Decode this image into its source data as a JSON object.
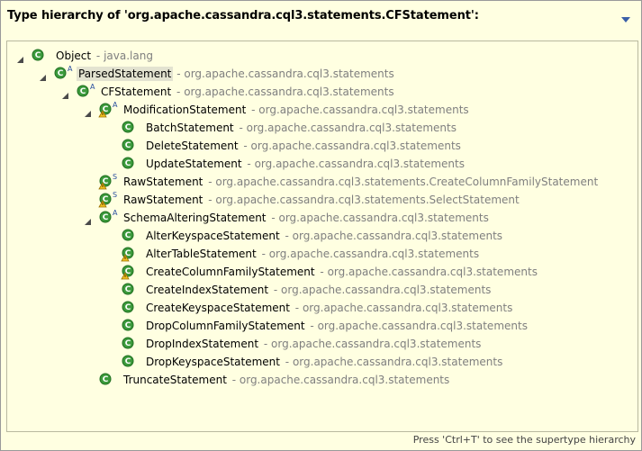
{
  "title": "Type hierarchy of 'org.apache.cassandra.cql3.statements.CFStatement':",
  "menu_icon": "view-menu-triangle-icon",
  "status_text": "Press 'Ctrl+T' to see the supertype hierarchy",
  "colors": {
    "background": "#ffffe1",
    "class_icon_green": "#3c9a3c",
    "package_gray": "#7f7f7f",
    "title_menu_blue": "#3a5fa8"
  },
  "rows": [
    {
      "level": 0,
      "expander": "expanded",
      "icon": "class",
      "badge": "",
      "warn": false,
      "name": "Object",
      "sep": " - ",
      "pkg": "java.lang",
      "selected": false
    },
    {
      "level": 1,
      "expander": "expanded",
      "icon": "class",
      "badge": "A",
      "warn": false,
      "name": "ParsedStatement",
      "sep": " - ",
      "pkg": "org.apache.cassandra.cql3.statements",
      "selected": true
    },
    {
      "level": 2,
      "expander": "expanded",
      "icon": "class",
      "badge": "A",
      "warn": false,
      "name": "CFStatement",
      "sep": " - ",
      "pkg": "org.apache.cassandra.cql3.statements",
      "selected": false
    },
    {
      "level": 3,
      "expander": "expanded",
      "icon": "class",
      "badge": "A",
      "warn": true,
      "name": "ModificationStatement",
      "sep": " - ",
      "pkg": "org.apache.cassandra.cql3.statements",
      "selected": false
    },
    {
      "level": 4,
      "expander": "none",
      "icon": "class",
      "badge": "",
      "warn": false,
      "name": "BatchStatement",
      "sep": " - ",
      "pkg": "org.apache.cassandra.cql3.statements",
      "selected": false
    },
    {
      "level": 4,
      "expander": "none",
      "icon": "class",
      "badge": "",
      "warn": false,
      "name": "DeleteStatement",
      "sep": " - ",
      "pkg": "org.apache.cassandra.cql3.statements",
      "selected": false
    },
    {
      "level": 4,
      "expander": "none",
      "icon": "class",
      "badge": "",
      "warn": false,
      "name": "UpdateStatement",
      "sep": " - ",
      "pkg": "org.apache.cassandra.cql3.statements",
      "selected": false
    },
    {
      "level": 3,
      "expander": "none",
      "icon": "class",
      "badge": "S",
      "warn": true,
      "name": "RawStatement",
      "sep": " - ",
      "pkg": "org.apache.cassandra.cql3.statements.CreateColumnFamilyStatement",
      "selected": false
    },
    {
      "level": 3,
      "expander": "none",
      "icon": "class",
      "badge": "S",
      "warn": true,
      "name": "RawStatement",
      "sep": " - ",
      "pkg": "org.apache.cassandra.cql3.statements.SelectStatement",
      "selected": false
    },
    {
      "level": 3,
      "expander": "expanded",
      "icon": "class",
      "badge": "A",
      "warn": false,
      "name": "SchemaAlteringStatement",
      "sep": " - ",
      "pkg": "org.apache.cassandra.cql3.statements",
      "selected": false
    },
    {
      "level": 4,
      "expander": "none",
      "icon": "class",
      "badge": "",
      "warn": false,
      "name": "AlterKeyspaceStatement",
      "sep": " - ",
      "pkg": "org.apache.cassandra.cql3.statements",
      "selected": false
    },
    {
      "level": 4,
      "expander": "none",
      "icon": "class",
      "badge": "",
      "warn": true,
      "name": "AlterTableStatement",
      "sep": " - ",
      "pkg": "org.apache.cassandra.cql3.statements",
      "selected": false
    },
    {
      "level": 4,
      "expander": "none",
      "icon": "class",
      "badge": "",
      "warn": true,
      "name": "CreateColumnFamilyStatement",
      "sep": " - ",
      "pkg": "org.apache.cassandra.cql3.statements",
      "selected": false
    },
    {
      "level": 4,
      "expander": "none",
      "icon": "class",
      "badge": "",
      "warn": false,
      "name": "CreateIndexStatement",
      "sep": " - ",
      "pkg": "org.apache.cassandra.cql3.statements",
      "selected": false
    },
    {
      "level": 4,
      "expander": "none",
      "icon": "class",
      "badge": "",
      "warn": false,
      "name": "CreateKeyspaceStatement",
      "sep": " - ",
      "pkg": "org.apache.cassandra.cql3.statements",
      "selected": false
    },
    {
      "level": 4,
      "expander": "none",
      "icon": "class",
      "badge": "",
      "warn": false,
      "name": "DropColumnFamilyStatement",
      "sep": " - ",
      "pkg": "org.apache.cassandra.cql3.statements",
      "selected": false
    },
    {
      "level": 4,
      "expander": "none",
      "icon": "class",
      "badge": "",
      "warn": false,
      "name": "DropIndexStatement",
      "sep": " - ",
      "pkg": "org.apache.cassandra.cql3.statements",
      "selected": false
    },
    {
      "level": 4,
      "expander": "none",
      "icon": "class",
      "badge": "",
      "warn": false,
      "name": "DropKeyspaceStatement",
      "sep": " - ",
      "pkg": "org.apache.cassandra.cql3.statements",
      "selected": false
    },
    {
      "level": 3,
      "expander": "none",
      "icon": "class",
      "badge": "",
      "warn": false,
      "name": "TruncateStatement",
      "sep": " - ",
      "pkg": "org.apache.cassandra.cql3.statements",
      "selected": false
    }
  ]
}
